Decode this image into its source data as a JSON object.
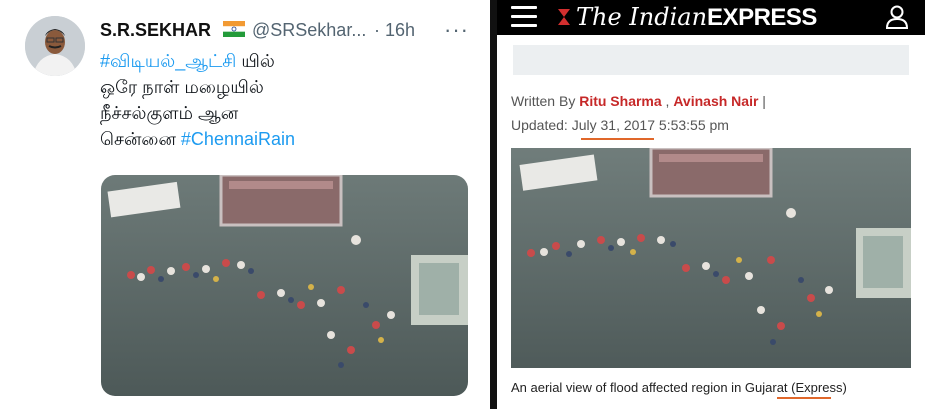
{
  "tweet": {
    "display_name": "S.R.SEKHAR",
    "flag_icon": "india-flag-icon",
    "handle": "@SRSekhar...",
    "separator": "·",
    "time": "16h",
    "more_icon": "more-dots-icon",
    "lines": [
      {
        "hashtag": "#விடியல்_ஆட்சி",
        "text": " யில்"
      },
      {
        "text": "ஒரே நாள் மழையில்"
      },
      {
        "text": "நீச்சல்குளம் ஆன"
      },
      {
        "text": "சென்னை ",
        "hashtag": "#ChennaiRain"
      }
    ],
    "colors": {
      "hashtag": "#1d9bf0",
      "text": "#0f1419",
      "muted": "#536471"
    }
  },
  "article": {
    "menu_icon": "hamburger-menu-icon",
    "logo_italic": "The Indian",
    "logo_bold": "EXPRESS",
    "user_icon": "user-account-icon",
    "byline_prefix": "Written By ",
    "author1": "Ritu Sharma",
    "byline_sep": " , ",
    "author2": "Avinash Nair",
    "byline_suffix": " |",
    "updated_prefix": "Updated: ",
    "updated_date": "July 31, 2017",
    "updated_time": " 5:53:55 pm",
    "caption_prefix": "An aerial view of flood affected region in ",
    "caption_place": "Gujarat",
    "caption_suffix": " (Express)",
    "colors": {
      "author": "#c62828",
      "underline": "#e0672a"
    }
  }
}
